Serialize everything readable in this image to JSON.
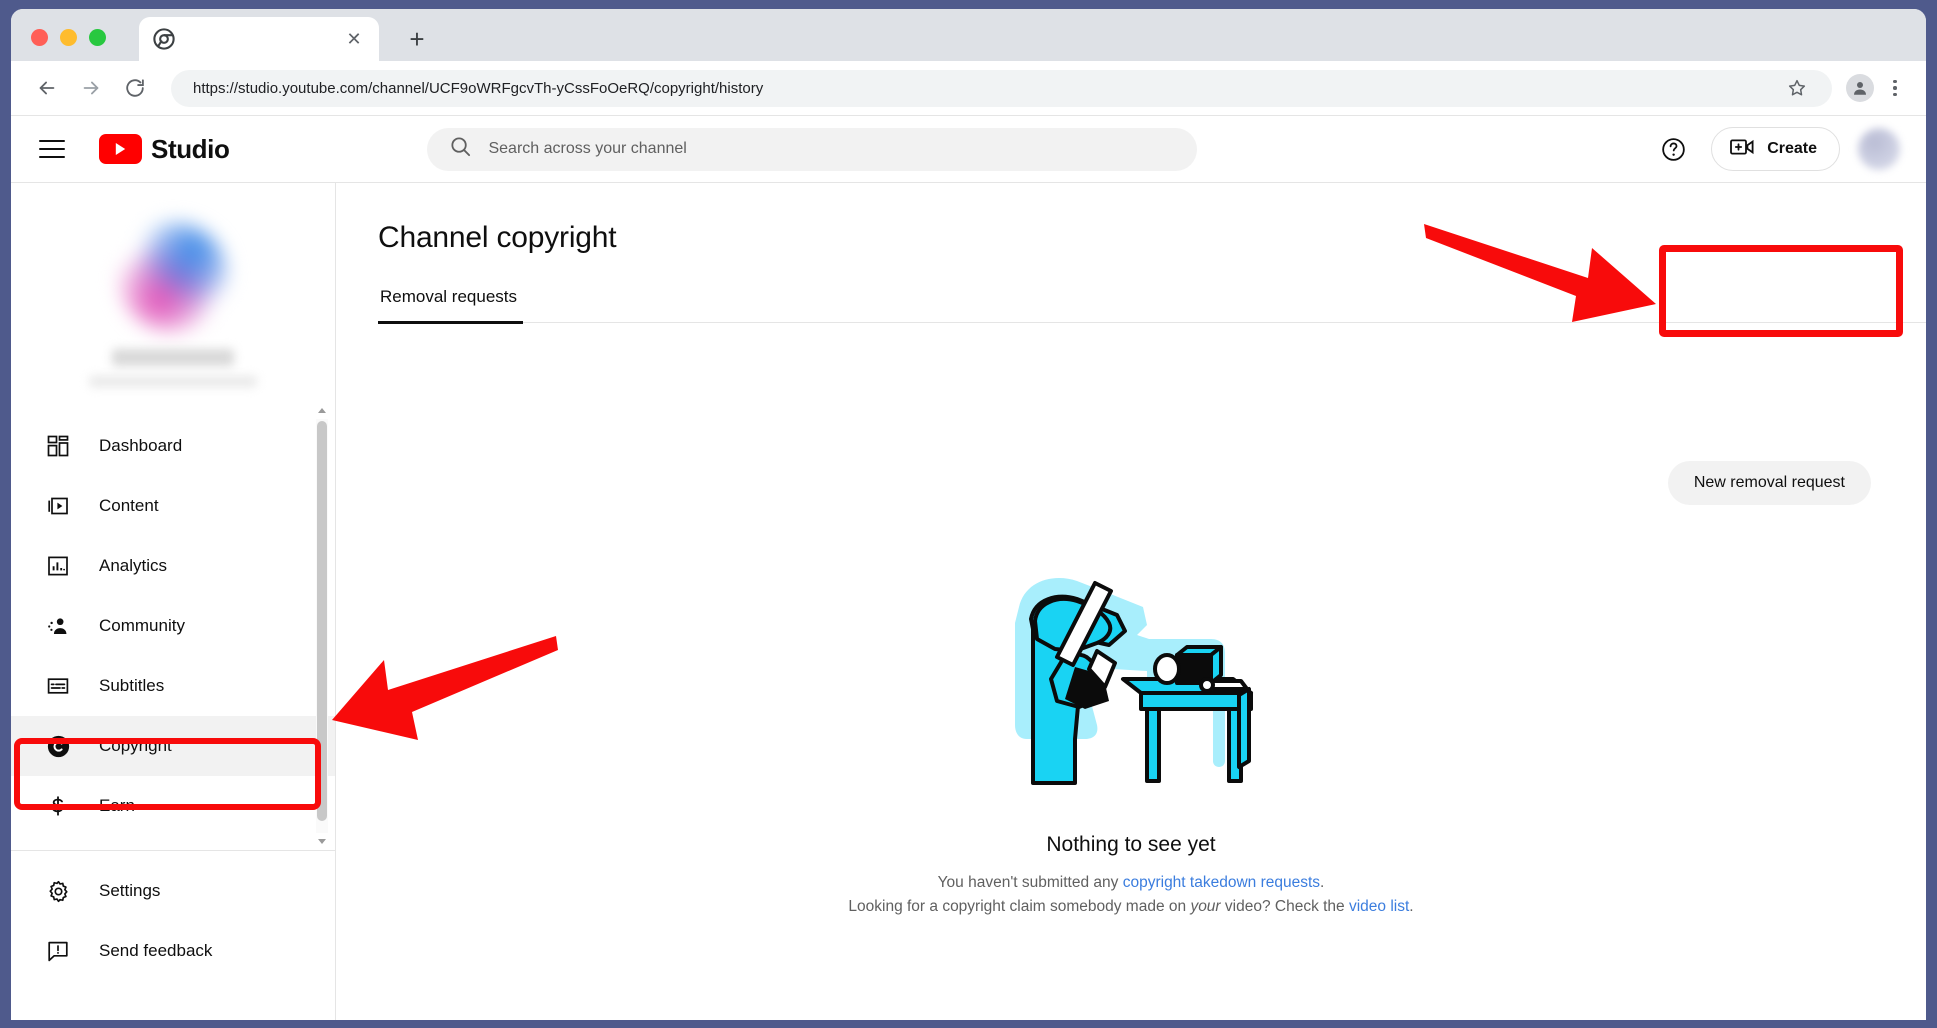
{
  "browser": {
    "tab": {
      "title": "",
      "favicon_icon": "chrome-icon",
      "close_icon": "close-icon"
    },
    "new_tab_label": "+",
    "back_icon": "back-arrow-icon",
    "forward_icon": "forward-arrow-icon",
    "reload_icon": "reload-icon",
    "url": "https://studio.youtube.com/channel/UCF9oWRFgcvTh-yCssFoOeRQ/copyright/history",
    "bookmark_icon": "star-icon",
    "profile_icon": "account-icon",
    "menu_icon": "kebab-menu-icon",
    "traffic_lights": [
      "close-red",
      "minimize-yellow",
      "maximize-green"
    ]
  },
  "studio_header": {
    "menu_icon": "hamburger-icon",
    "logo_text": "Studio",
    "logo_icon": "youtube-play-icon",
    "search": {
      "icon": "search-icon",
      "placeholder": "Search across your channel",
      "value": ""
    },
    "help_icon": "help-question-icon",
    "create_label": "Create",
    "create_icon": "create-video-icon",
    "avatar_icon": "avatar"
  },
  "sidebar": {
    "channel": {
      "avatar_icon": "channel-avatar-blurred",
      "name": "",
      "handle": ""
    },
    "items": [
      {
        "label": "Dashboard",
        "icon": "dashboard-icon",
        "active": false
      },
      {
        "label": "Content",
        "icon": "content-video-icon",
        "active": false
      },
      {
        "label": "Analytics",
        "icon": "analytics-bar-icon",
        "active": false
      },
      {
        "label": "Community",
        "icon": "community-people-icon",
        "active": false
      },
      {
        "label": "Subtitles",
        "icon": "subtitles-icon",
        "active": false
      },
      {
        "label": "Copyright",
        "icon": "copyright-icon",
        "active": true
      },
      {
        "label": "Earn",
        "icon": "dollar-icon",
        "active": false
      }
    ],
    "footer_items": [
      {
        "label": "Settings",
        "icon": "gear-icon"
      },
      {
        "label": "Send feedback",
        "icon": "feedback-icon"
      }
    ],
    "scrollbar": {
      "up_icon": "scroll-up-arrow",
      "down_icon": "scroll-down-arrow"
    }
  },
  "main": {
    "page_title": "Channel copyright",
    "tabs": [
      {
        "label": "Removal requests",
        "active": true
      }
    ],
    "new_removal_button": "New removal request",
    "empty_state": {
      "illustration_icon": "person-filming-camera-illustration",
      "title": "Nothing to see yet",
      "line1_prefix": "You haven't submitted any ",
      "line1_link": "copyright takedown requests",
      "line1_suffix": ".",
      "line2_part1": "Looking for a copyright claim somebody made on ",
      "line2_em": "your",
      "line2_part2": " video? Check the ",
      "line2_link": "video list",
      "line2_suffix": "."
    }
  },
  "annotations": {
    "color": "#f80b0b",
    "highlight_boxes": [
      "copyright-sidebar-item",
      "new-removal-request-button"
    ],
    "arrows": [
      "arrow-pointing-to-new-removal-request",
      "arrow-pointing-to-copyright-menu"
    ]
  },
  "colors": {
    "brand_red": "#ff0000",
    "annotation_red": "#f80b0b",
    "link_blue": "#3b7dde",
    "illustration_cyan": "#19d3f3",
    "desktop_bg": "#4f5a8c"
  }
}
